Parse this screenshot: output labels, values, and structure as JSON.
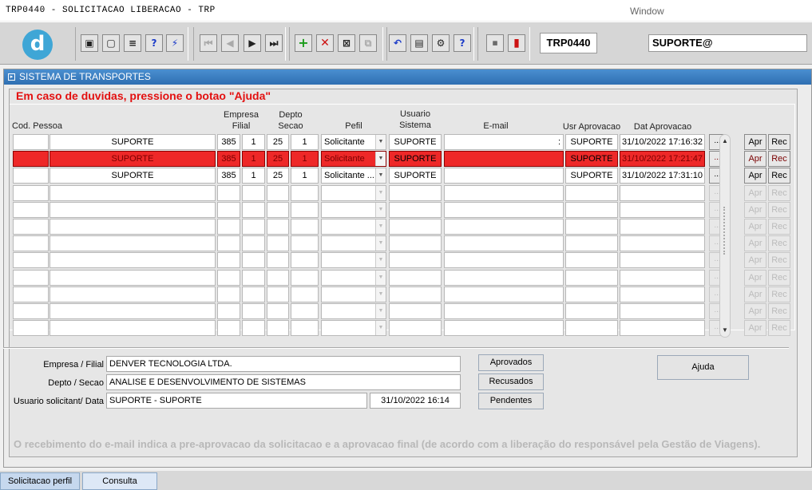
{
  "window": {
    "title": "TRP0440 - SOLICITACAO LIBERACAO - TRP",
    "menu_label": "Window"
  },
  "toolbar": {
    "logo_letter": "d",
    "form_code": "TRP0440",
    "user": "SUPORTE@"
  },
  "panel": {
    "title": "SISTEMA DE TRANSPORTES",
    "help_message": "Em caso de duvidas, pressione o botao \"Ajuda\""
  },
  "columns": {
    "cod_pessoa": "Cod. Pessoa",
    "empresa": "Empresa",
    "filial": "Filial",
    "depto": "Depto",
    "secao": "Secao",
    "pefil": "Pefil",
    "usuario": "Usuario",
    "sistema": "Sistema",
    "email": "E-mail",
    "usr_aprovacao": "Usr Aprovacao",
    "dat_aprovacao": "Dat Aprovacao"
  },
  "rows": [
    {
      "cod": "",
      "nome": "SUPORTE",
      "empresa": "385",
      "filial": "1",
      "depto": "25",
      "secao": "1",
      "perfil": "Solicitante",
      "usuario": "SUPORTE",
      "email": ":",
      "usr_aprov": "SUPORTE",
      "dat_aprov": "31/10/2022 17:16:32"
    },
    {
      "cod": "",
      "nome": "SUPORTE",
      "empresa": "385",
      "filial": "1",
      "depto": "25",
      "secao": "1",
      "perfil": "Solicitante",
      "usuario": "SUPORTE",
      "email": "",
      "usr_aprov": "SUPORTE",
      "dat_aprov": "31/10/2022 17:21:47"
    },
    {
      "cod": "",
      "nome": "SUPORTE",
      "empresa": "385",
      "filial": "1",
      "depto": "25",
      "secao": "1",
      "perfil": "Solicitante ...",
      "usuario": "SUPORTE",
      "email": "",
      "usr_aprov": "SUPORTE",
      "dat_aprov": "31/10/2022 17:31:10"
    }
  ],
  "row_buttons": {
    "dots": "...",
    "approve": "Apr",
    "reject": "Rec"
  },
  "details": {
    "empresa_label": "Empresa / Filial",
    "empresa_value": "DENVER TECNOLOGIA LTDA.",
    "depto_label": "Depto / Secao",
    "depto_value": "ANALISE E DESENVOLVIMENTO DE SISTEMAS",
    "usuario_label": "Usuario solicitant/ Data",
    "usuario_value": "SUPORTE - SUPORTE",
    "data_value": "31/10/2022 16:14"
  },
  "buttons": {
    "aprovados": "Aprovados",
    "recusados": "Recusados",
    "pendentes": "Pendentes",
    "ajuda": "Ajuda"
  },
  "footer_note": "O recebimento do e-mail indica a pre-aprovacao da solicitacao e a aprovacao final (de acordo com a liberação do responsável pela Gestão de Viagens).",
  "tabs": [
    {
      "label": "Solicitacao perfil",
      "active": true
    },
    {
      "label": "Consulta",
      "active": false
    }
  ],
  "colors": {
    "selected_row": "#ee2828",
    "help_text": "#e31010",
    "header_blue": "#3b7fc4"
  }
}
